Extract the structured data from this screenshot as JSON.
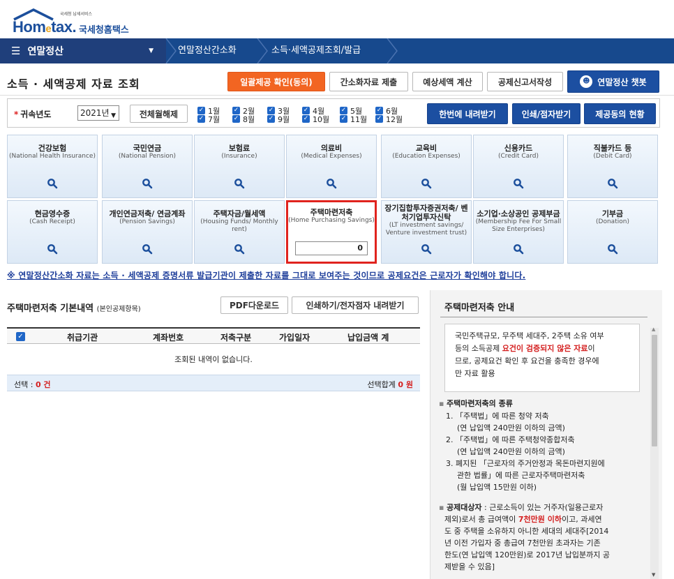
{
  "logo": {
    "small": "국세청 납세서비스",
    "brand_en_a": "Hom",
    "brand_en_b": "e",
    "brand_en_c": "tax.",
    "brand_ko": "국세청홈택스"
  },
  "nav": {
    "menu_label": "연말정산",
    "crumb1": "연말정산간소화",
    "crumb2": "소득·세액공제조회/발급"
  },
  "title": "소득 · 세액공제 자료 조회",
  "toolbar": {
    "btn_consent": "일괄제공 확인(동의)",
    "btn_submit": "간소화자료 제출",
    "btn_estimate": "예상세액 계산",
    "btn_report": "공제신고서작성",
    "btn_chatbot": "연말정산 챗봇"
  },
  "filter": {
    "year_label": "귀속년도",
    "year_value": "2021년",
    "btn_clear": "전체월해제",
    "months": [
      "1월",
      "2월",
      "3월",
      "4월",
      "5월",
      "6월",
      "7월",
      "8월",
      "9월",
      "10월",
      "11월",
      "12월"
    ],
    "btn_download_all": "한번에 내려받기",
    "btn_print": "인쇄/점자받기",
    "btn_status": "제공동의 현황"
  },
  "tiles": [
    {
      "ko": "건강보험",
      "en": "(National Health Insurance)"
    },
    {
      "ko": "국민연금",
      "en": "(National Pension)"
    },
    {
      "ko": "보험료",
      "en": "(Insurance)"
    },
    {
      "ko": "의료비",
      "en": "(Medical Expenses)"
    },
    {
      "ko": "교육비",
      "en": "(Education Expenses)"
    },
    {
      "ko": "신용카드",
      "en": "(Credit Card)"
    },
    {
      "ko": "직불카드 등",
      "en": "(Debit Card)"
    },
    {
      "ko": "현금영수증",
      "en": "(Cash Receipt)"
    },
    {
      "ko": "개인연금저축/ 연금계좌",
      "en": "(Pension Savings)"
    },
    {
      "ko": "주택자금/월세액",
      "en": "(Housing Funds/ Monthly rent)"
    },
    {
      "ko": "주택마련저축",
      "en": "(Home Purchasing Savings)",
      "value": "0"
    },
    {
      "ko": "장기집합투자증권저축/ 벤처기업투자신탁",
      "en": "(LT investment savings/ Venture investment trust)"
    },
    {
      "ko": "소기업·소상공인 공제부금",
      "en": "(Membership Fee For Small Size Enterprises)"
    },
    {
      "ko": "기부금",
      "en": "(Donation)"
    }
  ],
  "notice": "※ 연말정산간소화 자료는 소득 · 세액공제 증명서류 발급기관이 제출한 자료를 그대로 보여주는 것이므로 공제요건은 근로자가 확인해야 합니다.",
  "section": {
    "title": "주택마련저축 기본내역",
    "title_small": "(본인공제항목)",
    "btn_pdf": "PDF다운로드",
    "btn_print_dl": "인쇄하기/전자점자 내려받기",
    "columns": [
      "취급기관",
      "계좌번호",
      "저축구분",
      "가입일자",
      "납입금액 계"
    ],
    "empty": "조회된 내역이 없습니다.",
    "sum_left_label": "선택 : ",
    "sum_left_value": "0 건",
    "sum_right_label": "선택합계 ",
    "sum_right_value": "0 원"
  },
  "guide": {
    "title": "주택마련저축 안내",
    "box_l1": "국민주택규모, 무주택 세대주, 2주택 소유 여부",
    "box_l2a": "등의 소득공제 ",
    "box_l2b": "요건이 검증되지 않은 자료",
    "box_l2c": "이",
    "box_l3": "므로, 공제요건 확인 후 요건을 충족한 경우에",
    "box_l4": "만 자료 활용",
    "kinds_title": "주택마련저축의 종류",
    "k1": "1. 「주택법」에 따른 청약 저축",
    "k1s": "(연 납입액 240만원 이하의 금액)",
    "k2": "2. 「주택법」에 따른 주택청약종합저축",
    "k2s": "(연 납입액 240만원 이하의 금액)",
    "k3": "3. 폐지된 「근로자의 주거안정과 목돈마련지원에",
    "k3b": "관한 법률」에 따른 근로자주택마련저축",
    "k3s": "(월 납입액 15만원 이하)",
    "t_label": "공제대상자",
    "t1": " : 근로소득이 있는 거주자(일용근로자",
    "t2a": "제외)로서 총 급여액이 ",
    "t2b": "7천만원 이하",
    "t2c": "이고, 과세연",
    "t3": "도 중 주택을 소유하지 아니한 세대의 세대주[2014",
    "t4": "년 이전 가입자 중 총급여 7천만원 초과자는 기존",
    "t5": "한도(연 납입액 120만원)로 2017년 납입분까지 공",
    "t6": "제받을 수 있음]"
  }
}
